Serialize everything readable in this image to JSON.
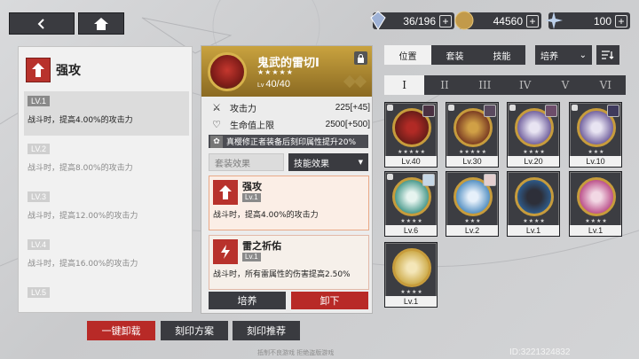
{
  "top_bar": {
    "resources": [
      {
        "value": "36/196",
        "icon": "crystal-icon"
      },
      {
        "value": "44560",
        "icon": "coin-icon"
      },
      {
        "value": "100",
        "icon": "star-shard-icon"
      }
    ],
    "plus": "+"
  },
  "left_panel": {
    "title": "强攻",
    "levels": [
      {
        "tag": "LV.1",
        "desc": "战斗时，提高4.00%的攻击力"
      },
      {
        "tag": "LV.2",
        "desc": "战斗时，提高8.00%的攻击力"
      },
      {
        "tag": "LV.3",
        "desc": "战斗时，提高12.00%的攻击力"
      },
      {
        "tag": "LV.4",
        "desc": "战斗时，提高16.00%的攻击力"
      },
      {
        "tag": "LV.5",
        "desc": ""
      }
    ]
  },
  "mid_panel": {
    "name": "鬼武的雷切I",
    "stars": "★★★★★",
    "lv_prefix": "Lv",
    "lv_value": "40/40",
    "stats": [
      {
        "icon": "attack-icon",
        "label": "攻击力",
        "value": "225[+45]"
      },
      {
        "icon": "hp-icon",
        "label": "生命值上限",
        "value": "2500[+500]"
      }
    ],
    "buff": "真樱修正者装备后刻印属性提升20%",
    "tabs": {
      "set": "套装效果",
      "skill": "技能效果"
    },
    "effects": [
      {
        "name": "强攻",
        "lv": "Lv.1",
        "desc": "战斗时，提高4.00%的攻击力"
      },
      {
        "name": "雷之祈佑",
        "lv": "Lv.1",
        "desc": "战斗时，所有雷属性的伤害提高2.50%"
      }
    ],
    "upgrade": "培养",
    "unequip": "卸下"
  },
  "right_panel": {
    "tabs": [
      "位置",
      "套装",
      "技能"
    ],
    "culture": "培养",
    "romans": [
      "I",
      "II",
      "III",
      "IV",
      "V",
      "VI"
    ],
    "cards": [
      {
        "lv": "Lv.40",
        "stars": "★★★★★",
        "color": "#b12a25"
      },
      {
        "lv": "Lv.30",
        "stars": "★★★★★",
        "color": "#8e2a22"
      },
      {
        "lv": "Lv.20",
        "stars": "★★★★",
        "color": "#6b4fa0"
      },
      {
        "lv": "Lv.10",
        "stars": "★★★",
        "color": "#6b4fa0"
      },
      {
        "lv": "Lv.6",
        "stars": "★★★★",
        "color": "#2f8a7b"
      },
      {
        "lv": "Lv.2",
        "stars": "★★★",
        "color": "#3b7fb8"
      },
      {
        "lv": "Lv.1",
        "stars": "★★★★",
        "color": "#2f6fb0"
      },
      {
        "lv": "Lv.1",
        "stars": "★★★★",
        "color": "#b23a7c"
      },
      {
        "lv": "Lv.1",
        "stars": "★★★★",
        "color": "#c7a23a"
      }
    ]
  },
  "bottom": {
    "unload_all": "一键卸载",
    "plan": "刻印方案",
    "recommend": "刻印推荐",
    "note": "抵制不良游戏 拒绝盗版游戏",
    "uid": "ID:3221324832"
  }
}
